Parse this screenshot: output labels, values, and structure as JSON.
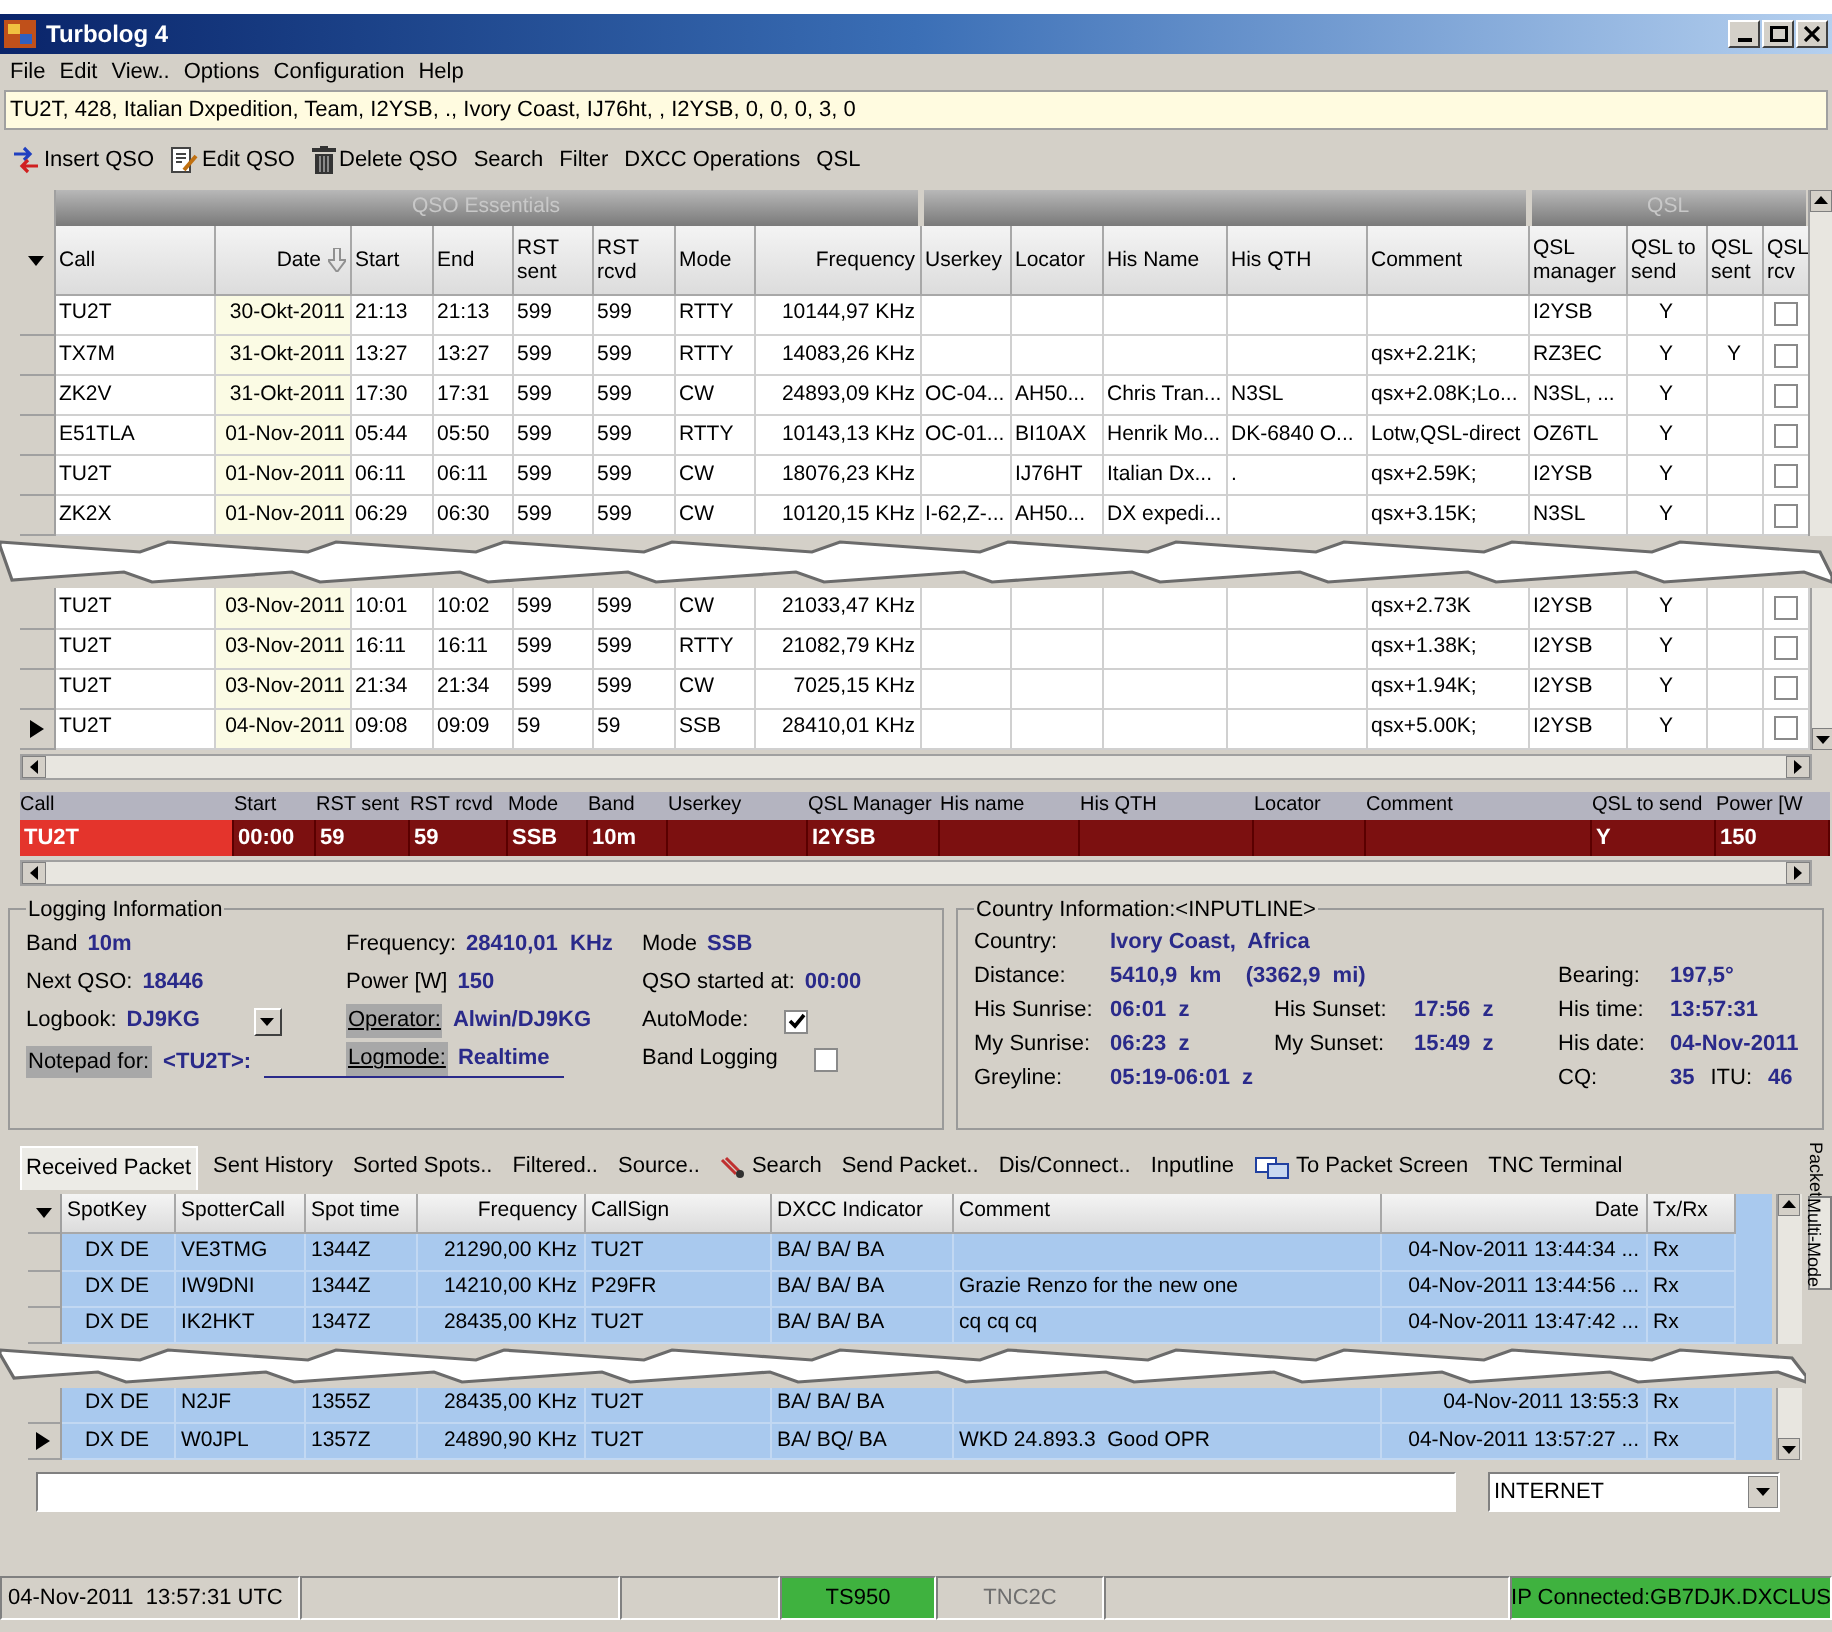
{
  "window": {
    "title": "Turbolog 4"
  },
  "menu": [
    "File",
    "Edit",
    "View..",
    "Options",
    "Configuration",
    "Help"
  ],
  "info_line": "TU2T, 428, Italian Dxpedition, Team, I2YSB, ., Ivory Coast, IJ76ht, , I2YSB, 0, 0, 0, 3, 0",
  "toolbar": [
    {
      "label": "Insert QSO",
      "kind": "icon"
    },
    {
      "label": "Edit QSO",
      "kind": "icon"
    },
    {
      "label": "Delete QSO",
      "kind": "icon"
    },
    {
      "label": "Search",
      "kind": "plain"
    },
    {
      "label": "Filter",
      "kind": "plain"
    },
    {
      "label": "DXCC Operations",
      "kind": "plain"
    },
    {
      "label": "QSL",
      "kind": "plain"
    }
  ],
  "qso_table": {
    "column_groups": [
      "QSO Essentials",
      "QSL"
    ],
    "columns": [
      "Call",
      "Date",
      "Start",
      "End",
      "RST sent",
      "RST rcvd",
      "Mode",
      "Frequency",
      "Userkey",
      "Locator",
      "His Name",
      "His QTH",
      "Comment",
      "QSL manager",
      "QSL to send",
      "QSL sent",
      "QSL rcv"
    ],
    "rows": [
      {
        "call": "TU2T",
        "date": "30-Okt-2011",
        "start": "21:13",
        "end": "21:13",
        "rst_sent": "599",
        "rst_rcvd": "599",
        "mode": "RTTY",
        "frequency": "10144,97 KHz",
        "qsl_manager": "I2YSB",
        "qsl_to_send": "Y",
        "qsl_rcvd": false,
        "selected": false
      },
      {
        "call": "TX7M",
        "date": "31-Okt-2011",
        "start": "13:27",
        "end": "13:27",
        "rst_sent": "599",
        "rst_rcvd": "599",
        "mode": "RTTY",
        "frequency": "14083,26 KHz",
        "comment": "qsx+2.21K;",
        "qsl_manager": "RZ3EC",
        "qsl_to_send": "Y",
        "qsl_sent": "Y",
        "qsl_rcvd": false,
        "selected": false
      },
      {
        "call": "ZK2V",
        "date": "31-Okt-2011",
        "start": "17:30",
        "end": "17:31",
        "rst_sent": "599",
        "rst_rcvd": "599",
        "mode": "CW",
        "frequency": "24893,09 KHz",
        "userkey": "OC-04...",
        "locator": "AH50...",
        "his_name": "Chris Tran...",
        "his_qth": "N3SL",
        "comment": "qsx+2.08K;Lo...",
        "qsl_manager": "N3SL, ...",
        "qsl_to_send": "Y",
        "qsl_rcvd": false,
        "selected": false
      },
      {
        "call": "E51TLA",
        "date": "01-Nov-2011",
        "start": "05:44",
        "end": "05:50",
        "rst_sent": "599",
        "rst_rcvd": "599",
        "mode": "RTTY",
        "frequency": "10143,13 KHz",
        "userkey": "OC-01...",
        "locator": "BI10AX",
        "his_name": "Henrik Mo...",
        "his_qth": "DK-6840 O...",
        "comment": "Lotw,QSL-direct",
        "qsl_manager": "OZ6TL",
        "qsl_to_send": "Y",
        "qsl_rcvd": false,
        "selected": false
      },
      {
        "call": "TU2T",
        "date": "01-Nov-2011",
        "start": "06:11",
        "end": "06:11",
        "rst_sent": "599",
        "rst_rcvd": "599",
        "mode": "CW",
        "frequency": "18076,23 KHz",
        "locator": "IJ76HT",
        "his_name": "Italian Dx...",
        "his_qth": ".",
        "comment": "qsx+2.59K;",
        "qsl_manager": "I2YSB",
        "qsl_to_send": "Y",
        "qsl_rcvd": false,
        "selected": false
      },
      {
        "call": "ZK2X",
        "date": "01-Nov-2011",
        "start": "06:29",
        "end": "06:30",
        "rst_sent": "599",
        "rst_rcvd": "599",
        "mode": "CW",
        "frequency": "10120,15 KHz",
        "userkey": "I-62,Z-...",
        "locator": "AH50...",
        "his_name": "DX expedi...",
        "comment": "qsx+3.15K;",
        "qsl_manager": "N3SL",
        "qsl_to_send": "Y",
        "qsl_rcvd": false,
        "selected": false
      },
      {
        "call": "TU2T",
        "date": "03-Nov-2011",
        "start": "10:01",
        "end": "10:02",
        "rst_sent": "599",
        "rst_rcvd": "599",
        "mode": "CW",
        "frequency": "21033,47 KHz",
        "comment": "qsx+2.73K",
        "qsl_manager": "I2YSB",
        "qsl_to_send": "Y",
        "qsl_rcvd": false,
        "selected": false
      },
      {
        "call": "TU2T",
        "date": "03-Nov-2011",
        "start": "16:11",
        "end": "16:11",
        "rst_sent": "599",
        "rst_rcvd": "599",
        "mode": "RTTY",
        "frequency": "21082,79 KHz",
        "comment": "qsx+1.38K;",
        "qsl_manager": "I2YSB",
        "qsl_to_send": "Y",
        "qsl_rcvd": false,
        "selected": false
      },
      {
        "call": "TU2T",
        "date": "03-Nov-2011",
        "start": "21:34",
        "end": "21:34",
        "rst_sent": "599",
        "rst_rcvd": "599",
        "mode": "CW",
        "frequency": "7025,15 KHz",
        "comment": "qsx+1.94K;",
        "qsl_manager": "I2YSB",
        "qsl_to_send": "Y",
        "qsl_rcvd": false,
        "selected": false
      },
      {
        "call": "TU2T",
        "date": "04-Nov-2011",
        "start": "09:08",
        "end": "09:09",
        "rst_sent": "59",
        "rst_rcvd": "59",
        "mode": "SSB",
        "frequency": "28410,01 KHz",
        "comment": "qsx+5.00K;",
        "qsl_manager": "I2YSB",
        "qsl_to_send": "Y",
        "qsl_rcvd": false,
        "selected": true
      }
    ]
  },
  "entry_row": [
    {
      "label": "Call",
      "value": "TU2T"
    },
    {
      "label": "Start",
      "value": "00:00"
    },
    {
      "label": "RST sent",
      "value": "59"
    },
    {
      "label": "RST rcvd",
      "value": "59"
    },
    {
      "label": "Mode",
      "value": "SSB"
    },
    {
      "label": "Band",
      "value": "10m"
    },
    {
      "label": "Userkey"
    },
    {
      "label": "QSL Manager",
      "value": "I2YSB"
    },
    {
      "label": "His name"
    },
    {
      "label": "His QTH"
    },
    {
      "label": "Locator"
    },
    {
      "label": "Comment"
    },
    {
      "label": "QSL to send",
      "value": "Y"
    },
    {
      "label": "Power [W",
      "value": "150"
    }
  ],
  "logging_information": {
    "title": "Logging Information",
    "column_1": [
      {
        "kind": "pair",
        "label": "Band",
        "value": "10m"
      },
      {
        "kind": "pair",
        "label": "Next QSO:",
        "value": "18446"
      },
      {
        "kind": "dropdown",
        "label": "Logbook:",
        "value": "DJ9KG"
      }
    ],
    "column_2": [
      {
        "kind": "pair",
        "label": "Frequency:",
        "value": "28410,01  KHz"
      },
      {
        "kind": "pair",
        "label": "Power [W]",
        "value": "150"
      },
      {
        "kind": "tagged",
        "label": "Operator:",
        "value": "Alwin/DJ9KG"
      },
      {
        "kind": "tagged",
        "label": "Logmode:",
        "value": "Realtime"
      }
    ],
    "column_3": [
      {
        "kind": "pair",
        "label": "Mode",
        "value": "SSB"
      },
      {
        "kind": "pair",
        "label": "QSO started at:",
        "value": "00:00"
      },
      {
        "kind": "checkbox",
        "label": "AutoMode:",
        "checked": true
      },
      {
        "kind": "checkbox",
        "label": "Band Logging",
        "checked": false
      }
    ],
    "notepad": {
      "label": "Notepad for:",
      "value": "<TU2T>:"
    }
  },
  "country_information": {
    "title": "Country Information:<INPUTLINE>",
    "rows": [
      {
        "left": [
          {
            "label": "Country:",
            "value": "Ivory Coast,  Africa"
          }
        ]
      },
      {
        "left": [
          {
            "label": "Distance:",
            "value": "5410,9  km    (3362,9  mi)"
          }
        ],
        "right": [
          {
            "label": "Bearing:",
            "value": "197,5°"
          }
        ]
      },
      {
        "left": [
          {
            "label": "His Sunrise:",
            "value": "06:01  z"
          }
        ],
        "middle": [
          {
            "label": "His Sunset:",
            "value": "17:56  z"
          }
        ],
        "right": [
          {
            "label": "His time:",
            "value": "13:57:31"
          }
        ]
      },
      {
        "left": [
          {
            "label": "My Sunrise:",
            "value": "06:23  z"
          }
        ],
        "middle": [
          {
            "label": "My Sunset:",
            "value": "15:49  z"
          }
        ],
        "right": [
          {
            "label": "His date:",
            "value": "04-Nov-2011"
          }
        ]
      },
      {
        "left": [
          {
            "label": "Greyline:",
            "value": "05:19-06:01  z"
          }
        ],
        "right": [
          {
            "label": "CQ:",
            "value": "35"
          },
          {
            "label": "ITU:",
            "value": "46"
          }
        ]
      }
    ]
  },
  "packet_tabs": [
    {
      "label": "Received Packet",
      "kind": "plain",
      "selected": true
    },
    {
      "label": "Sent History",
      "kind": "plain",
      "selected": false
    },
    {
      "label": "Sorted Spots..",
      "kind": "plain",
      "selected": false
    },
    {
      "label": "Filtered..",
      "kind": "plain",
      "selected": false
    },
    {
      "label": "Source..",
      "kind": "plain",
      "selected": false
    },
    {
      "label": "Search",
      "kind": "icon",
      "selected": false
    },
    {
      "label": "Send Packet..",
      "kind": "plain",
      "selected": false
    },
    {
      "label": "Dis/Connect..",
      "kind": "plain",
      "selected": false
    },
    {
      "label": "Inputline",
      "kind": "plain",
      "selected": false
    },
    {
      "label": "To Packet Screen",
      "kind": "icon",
      "selected": false
    },
    {
      "label": "TNC Terminal",
      "kind": "plain",
      "selected": false
    }
  ],
  "side_tabs": [
    {
      "label": "Packet",
      "selected": true
    },
    {
      "label": "Multi-Mode",
      "selected": false
    }
  ],
  "spot_table": {
    "columns": [
      "SpotKey",
      "SpotterCall",
      "Spot time",
      "Frequency",
      "CallSign",
      "DXCC Indicator",
      "Comment",
      "Date",
      "Tx/Rx"
    ],
    "rows": [
      {
        "spotkey": "DX DE",
        "spotter_call": "VE3TMG",
        "spot_time": "1344Z",
        "frequency": "21290,00 KHz",
        "callsign": "TU2T",
        "dxcc_indicator": "BA/ BA/ BA",
        "date": "04-Nov-2011 13:44:34 ...",
        "tx_rx": "Rx",
        "selected": false
      },
      {
        "spotkey": "DX DE",
        "spotter_call": "IW9DNI",
        "spot_time": "1344Z",
        "frequency": "14210,00 KHz",
        "callsign": "P29FR",
        "dxcc_indicator": "BA/ BA/ BA",
        "comment": "Grazie Renzo for the new one",
        "date": "04-Nov-2011 13:44:56 ...",
        "tx_rx": "Rx",
        "selected": false
      },
      {
        "spotkey": "DX DE",
        "spotter_call": "IK2HKT",
        "spot_time": "1347Z",
        "frequency": "28435,00 KHz",
        "callsign": "TU2T",
        "dxcc_indicator": "BA/ BA/ BA",
        "comment": "cq cq cq",
        "date": "04-Nov-2011 13:47:42 ...",
        "tx_rx": "Rx",
        "selected": false
      },
      {
        "spotkey": "DX DE",
        "spotter_call": "N2JF",
        "spot_time": "1355Z",
        "frequency": "28435,00 KHz",
        "callsign": "TU2T",
        "dxcc_indicator": "BA/ BA/ BA",
        "date": "04-Nov-2011 13:55:3",
        "tx_rx": "Rx",
        "selected": false
      },
      {
        "spotkey": "DX DE",
        "spotter_call": "W0JPL",
        "spot_time": "1357Z",
        "frequency": "24890,90 KHz",
        "callsign": "TU2T",
        "dxcc_indicator": "BA/ BQ/ BA",
        "comment": "WKD 24.893.3  Good OPR",
        "date": "04-Nov-2011 13:57:27 ...",
        "tx_rx": "Rx",
        "selected": true
      }
    ]
  },
  "connection_dropdown": {
    "value": "INTERNET"
  },
  "status_bar": [
    {
      "kind": "text",
      "text": "04-Nov-2011  13:57:31 UTC"
    },
    {
      "kind": "empty"
    },
    {
      "kind": "empty"
    },
    {
      "kind": "ok",
      "text": "TS950"
    },
    {
      "kind": "disabled",
      "text": "TNC2C"
    },
    {
      "kind": "empty"
    },
    {
      "kind": "ok",
      "text": "IP Connected:GB7DJK.DXCLUS"
    }
  ]
}
